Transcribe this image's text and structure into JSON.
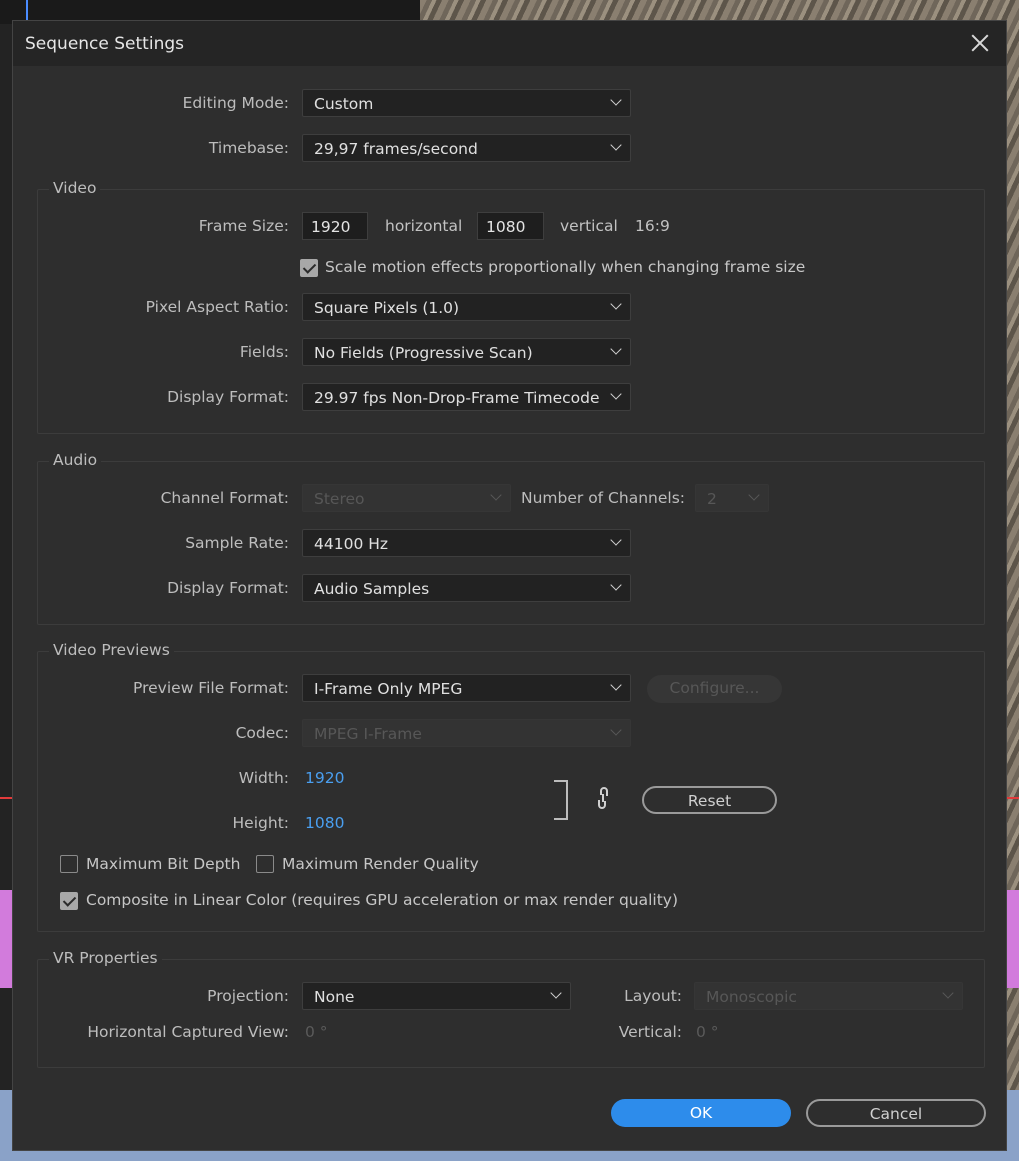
{
  "dialog": {
    "title": "Sequence Settings"
  },
  "general": {
    "editing_mode": {
      "label": "Editing Mode:",
      "value": "Custom"
    },
    "timebase": {
      "label": "Timebase:",
      "value": "29,97  frames/second"
    }
  },
  "video": {
    "title": "Video",
    "frame_size_label": "Frame Size:",
    "frame_width": "1920",
    "horizontal_label": "horizontal",
    "frame_height": "1080",
    "vertical_label": "vertical",
    "aspect": "16:9",
    "scale_motion": {
      "label": "Scale motion effects proportionally when changing frame size",
      "checked": true
    },
    "pixel_aspect": {
      "label": "Pixel Aspect Ratio:",
      "value": "Square Pixels (1.0)"
    },
    "fields": {
      "label": "Fields:",
      "value": "No Fields (Progressive Scan)"
    },
    "display_format": {
      "label": "Display Format:",
      "value": "29.97 fps Non-Drop-Frame Timecode"
    }
  },
  "audio": {
    "title": "Audio",
    "channel_format": {
      "label": "Channel Format:",
      "value": "Stereo"
    },
    "num_channels": {
      "label": "Number of Channels:",
      "value": "2"
    },
    "sample_rate": {
      "label": "Sample Rate:",
      "value": "44100 Hz"
    },
    "display_format": {
      "label": "Display Format:",
      "value": "Audio Samples"
    }
  },
  "previews": {
    "title": "Video Previews",
    "file_format": {
      "label": "Preview File Format:",
      "value": "I-Frame Only MPEG"
    },
    "configure_label": "Configure...",
    "codec": {
      "label": "Codec:",
      "value": "MPEG I-Frame"
    },
    "width_label": "Width:",
    "width_value": "1920",
    "height_label": "Height:",
    "height_value": "1080",
    "reset_label": "Reset",
    "max_bit_depth": {
      "label": "Maximum Bit Depth",
      "checked": false
    },
    "max_render_quality": {
      "label": "Maximum Render Quality",
      "checked": false
    },
    "composite_linear": {
      "label": "Composite in Linear Color (requires GPU acceleration or max render quality)",
      "checked": true
    }
  },
  "vr": {
    "title": "VR Properties",
    "projection": {
      "label": "Projection:",
      "value": "None"
    },
    "layout": {
      "label": "Layout:",
      "value": "Monoscopic"
    },
    "h_view": {
      "label": "Horizontal Captured View:",
      "value": "0 °"
    },
    "vertical": {
      "label": "Vertical:",
      "value": "0 °"
    }
  },
  "footer": {
    "ok_label": "OK",
    "cancel_label": "Cancel"
  },
  "colors": {
    "accent": "#2d8ceb",
    "link": "#4a9ff0",
    "dialog_bg": "#2e2e2e"
  }
}
